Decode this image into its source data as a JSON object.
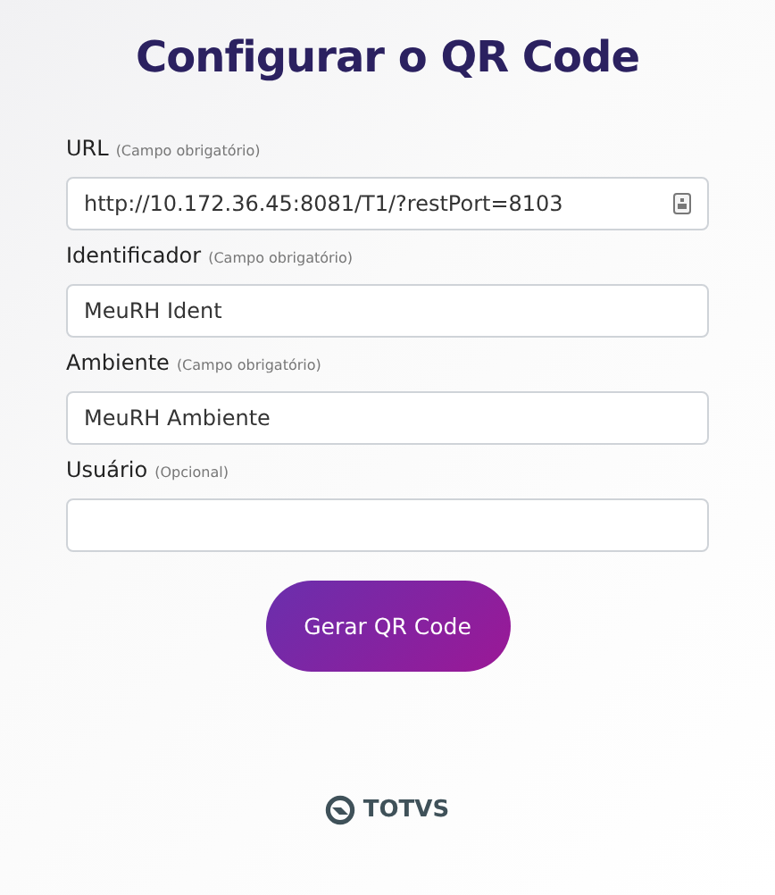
{
  "title": "Configurar o QR Code",
  "fields": [
    {
      "label": "URL",
      "note": "(Campo obrigatório)",
      "value": "http://10.172.36.45:8081/T1/?restPort=8103",
      "autofill_icon": true
    },
    {
      "label": "Identificador",
      "note": "(Campo obrigatório)",
      "value": "MeuRH Ident",
      "autofill_icon": false
    },
    {
      "label": "Ambiente",
      "note": "(Campo obrigatório)",
      "value": "MeuRH Ambiente",
      "autofill_icon": false
    },
    {
      "label": "Usuário",
      "note": "(Opcional)",
      "autofill_icon": false
    }
  ],
  "button": "Gerar QR Code",
  "logo": "TOTVS"
}
